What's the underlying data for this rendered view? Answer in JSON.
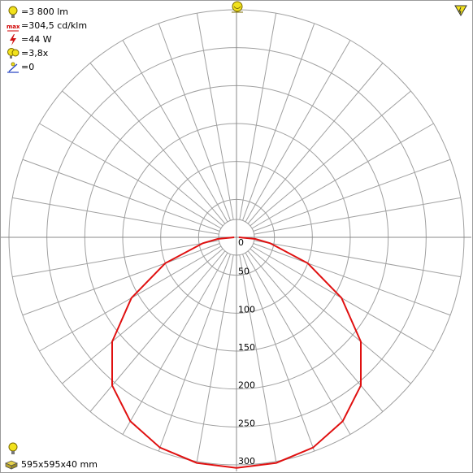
{
  "info": {
    "flux": "=3 800 lm",
    "max_intensity": "=304,5 cd/klm",
    "power": "=44 W",
    "efficacy": "=3,8x",
    "tilt": "=0"
  },
  "luminaire_dimensions": "595x595x40 mm",
  "colors": {
    "curve": "#e01010",
    "grid": "#a0a0a0",
    "icon_yellow": "#f2e21c"
  },
  "icons": [
    "lamp-icon",
    "max-icon",
    "power-icon",
    "efficacy-icon",
    "tilt-icon",
    "warning-icon",
    "luminaire-icon"
  ],
  "chart_data": {
    "type": "polar",
    "unit": "cd/klm",
    "radial_ticks": [
      "0",
      "50",
      "100",
      "150",
      "200",
      "250",
      "300"
    ],
    "rmax": 300,
    "angle_step_deg": 10,
    "series": [
      {
        "angles_deg": [
          0,
          10,
          20,
          30,
          40,
          50,
          60,
          70,
          80,
          85,
          90
        ],
        "values": [
          304,
          302,
          295,
          280,
          255,
          214,
          160,
          100,
          45,
          25,
          3
        ]
      }
    ]
  }
}
